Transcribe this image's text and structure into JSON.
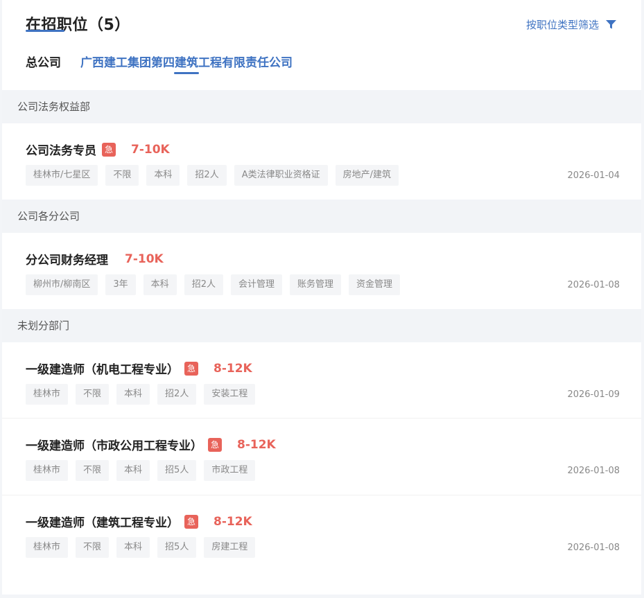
{
  "header": {
    "title": "在招职位（5）",
    "filter_label": "按职位类型筛选",
    "tabs": [
      {
        "label": "总公司"
      },
      {
        "label": "广西建工集团第四建筑工程有限责任公司"
      }
    ]
  },
  "sections": [
    {
      "name": "公司法务权益部",
      "jobs": [
        {
          "title": "公司法务专员",
          "urgent": "急",
          "salary": "7-10K",
          "tags": [
            "桂林市/七星区",
            "不限",
            "本科",
            "招2人",
            "A类法律职业资格证",
            "房地产/建筑"
          ],
          "date": "2026-01-04"
        }
      ]
    },
    {
      "name": "公司各分公司",
      "jobs": [
        {
          "title": "分公司财务经理",
          "salary": "7-10K",
          "tags": [
            "柳州市/柳南区",
            "3年",
            "本科",
            "招2人",
            "会计管理",
            "账务管理",
            "资金管理"
          ],
          "date": "2026-01-08"
        }
      ]
    },
    {
      "name": "未划分部门",
      "jobs": [
        {
          "title": "一级建造师（机电工程专业）",
          "urgent": "急",
          "salary": "8-12K",
          "tags": [
            "桂林市",
            "不限",
            "本科",
            "招2人",
            "安装工程"
          ],
          "date": "2026-01-09"
        },
        {
          "title": "一级建造师（市政公用工程专业）",
          "urgent": "急",
          "salary": "8-12K",
          "tags": [
            "桂林市",
            "不限",
            "本科",
            "招5人",
            "市政工程"
          ],
          "date": "2026-01-08"
        },
        {
          "title": "一级建造师（建筑工程专业）",
          "urgent": "急",
          "salary": "8-12K",
          "tags": [
            "桂林市",
            "不限",
            "本科",
            "招5人",
            "房建工程"
          ],
          "date": "2026-01-08"
        }
      ]
    }
  ],
  "colors": {
    "accent": "#3f73c2",
    "urgent": "#e8635a",
    "section_bg": "#f2f4f7"
  },
  "icons": {
    "filter": "funnel-icon"
  }
}
